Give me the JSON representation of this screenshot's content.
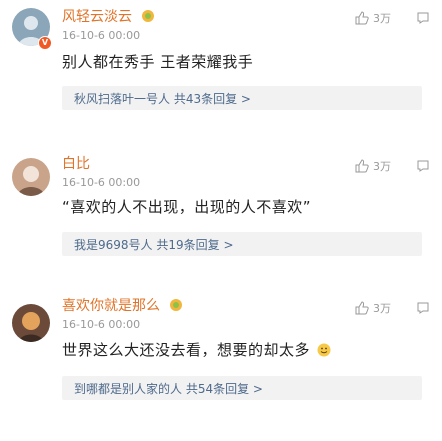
{
  "comments": [
    {
      "username": "风轻云淡云",
      "timestamp": "16-10-6 00:00",
      "content": "别人都在秀手 王者荣耀我手",
      "reply_summary": "秋风扫落叶一号人 共43条回复 >",
      "like_count": "3万",
      "has_vip_badge": true,
      "has_level_icon": true,
      "has_emoji": false,
      "colors": {
        "avatar_bg": "#8aa6b8",
        "avatar_fg": "#dfe7ee"
      }
    },
    {
      "username": "白比",
      "timestamp": "16-10-6 00:00",
      "content": "“喜欢的人不出现，出现的人不喜欢”",
      "reply_summary": "我是9698号人 共19条回复 >",
      "like_count": "3万",
      "has_vip_badge": false,
      "has_level_icon": false,
      "has_emoji": false,
      "colors": {
        "avatar_bg": "#c9a48a",
        "avatar_fg": "#f2e4d8"
      }
    },
    {
      "username": "喜欢你就是那么",
      "timestamp": "16-10-6 00:00",
      "content": "世界这么大还没去看，想要的却太多",
      "reply_summary": "到哪都是别人家的人 共54条回复 >",
      "like_count": "3万",
      "has_vip_badge": false,
      "has_level_icon": true,
      "has_emoji": true,
      "colors": {
        "avatar_bg": "#6b4a3a",
        "avatar_fg": "#e3a35d"
      }
    }
  ],
  "icons": {
    "like": "thumbs-up-outline-icon",
    "comment": "comment-bubble-icon",
    "level": "yellow-level-badge-icon",
    "emoji": "smiley-emoji-icon"
  },
  "colors": {
    "username": "#e0742a",
    "reply_link": "#4e6a8c",
    "meta": "#999999",
    "reply_bg": "#f2f2f2"
  }
}
